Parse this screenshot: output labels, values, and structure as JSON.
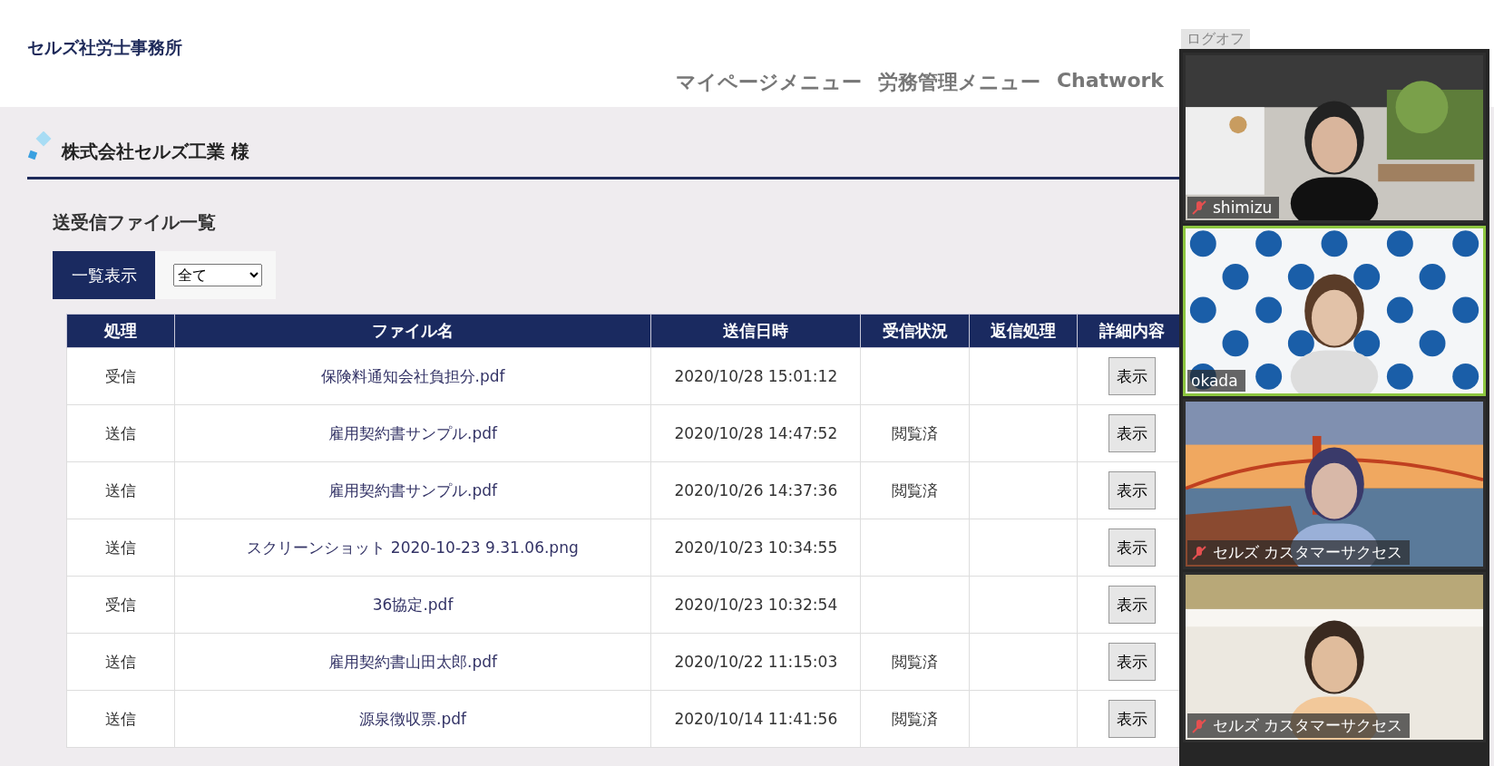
{
  "header": {
    "site_title": "セルズ社労士事務所",
    "nav": [
      "マイページメニュー",
      "労務管理メニュー",
      "Chatwork"
    ],
    "logoff": "ログオフ"
  },
  "company": {
    "name": "株式会社セルズ工業 様"
  },
  "section": {
    "title": "送受信ファイル一覧",
    "tabs": [
      {
        "label": "一覧表示",
        "selected": true
      }
    ],
    "filter": {
      "value": "全て"
    }
  },
  "table": {
    "columns": [
      "処理",
      "ファイル名",
      "送信日時",
      "受信状況",
      "返信処理",
      "詳細内容"
    ],
    "rows": [
      {
        "type": "受信",
        "file": "保険料通知会社負担分.pdf",
        "sent_at": "2020/10/28 15:01:12",
        "action": "表示"
      },
      {
        "type": "送信",
        "file": "雇用契約書サンプル.pdf",
        "sent_at": "2020/10/28 14:47:52",
        "status": "閲覧済",
        "action": "表示"
      },
      {
        "type": "送信",
        "file": "雇用契約書サンプル.pdf",
        "sent_at": "2020/10/26 14:37:36",
        "status": "閲覧済",
        "action": "表示"
      },
      {
        "type": "送信",
        "file": "スクリーンショット 2020-10-23 9.31.06.png",
        "sent_at": "2020/10/23 10:34:55",
        "action": "表示"
      },
      {
        "type": "受信",
        "file": "36協定.pdf",
        "sent_at": "2020/10/23 10:32:54",
        "action": "表示"
      },
      {
        "type": "送信",
        "file": "雇用契約書山田太郎.pdf",
        "sent_at": "2020/10/22 11:15:03",
        "status": "閲覧済",
        "action": "表示"
      },
      {
        "type": "送信",
        "file": "源泉徴収票.pdf",
        "sent_at": "2020/10/14 11:41:56",
        "status": "閲覧済",
        "action": "表示"
      }
    ]
  },
  "video_call": {
    "participants": [
      {
        "name": "shimizu",
        "muted": true,
        "active": false
      },
      {
        "name": "okada",
        "muted": false,
        "active": true
      },
      {
        "name": "セルズ カスタマーサクセス",
        "muted": true,
        "active": false
      },
      {
        "name": "セルズ カスタマーサクセス",
        "muted": true,
        "active": false
      }
    ]
  }
}
